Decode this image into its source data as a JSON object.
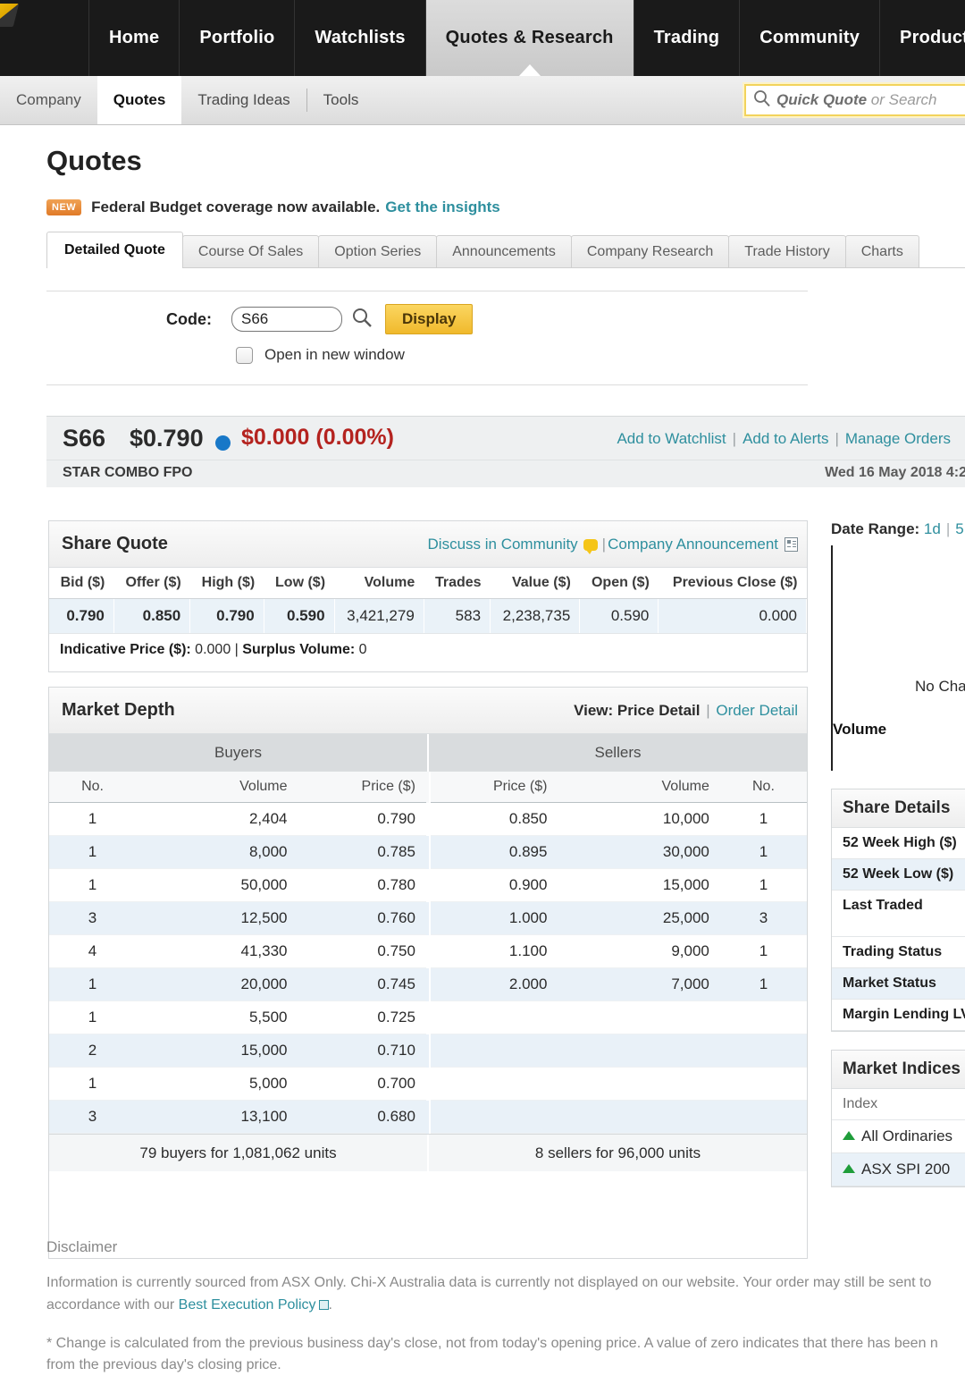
{
  "topnav": {
    "items": [
      {
        "label": "Home",
        "active": false
      },
      {
        "label": "Portfolio",
        "active": false
      },
      {
        "label": "Watchlists",
        "active": false
      },
      {
        "label": "Quotes & Research",
        "active": true
      },
      {
        "label": "Trading",
        "active": false
      },
      {
        "label": "Community",
        "active": false
      },
      {
        "label": "Products",
        "active": false
      }
    ]
  },
  "subnav": {
    "items": [
      "Company",
      "Quotes",
      "Trading Ideas",
      "Tools"
    ],
    "active": "Quotes",
    "search_placeholder_bold": "Quick Quote",
    "search_placeholder_rest": " or Search"
  },
  "page": {
    "title": "Quotes",
    "promo": {
      "badge": "NEW",
      "text": "Federal Budget coverage now available.",
      "link": "Get the insights"
    },
    "tabs": [
      {
        "label": "Detailed Quote",
        "active": true
      },
      {
        "label": "Course Of Sales",
        "active": false
      },
      {
        "label": "Option Series",
        "active": false
      },
      {
        "label": "Announcements",
        "active": false
      },
      {
        "label": "Company Research",
        "active": false
      },
      {
        "label": "Trade History",
        "active": false
      },
      {
        "label": "Charts",
        "active": false
      }
    ],
    "form": {
      "code_label": "Code:",
      "code_value": "S66",
      "display_button": "Display",
      "open_new_window": "Open in new window"
    }
  },
  "quote": {
    "code": "S66",
    "price": "$0.790",
    "change": "$0.000 (0.00%)",
    "company_name": "STAR COMBO FPO",
    "timestamp": "Wed 16 May 2018 4:2",
    "links": [
      "Add to Watchlist",
      "Add to Alerts",
      "Manage Orders"
    ],
    "dot_color": "#1878c8",
    "change_color": "#b4231f"
  },
  "share_quote": {
    "title": "Share Quote",
    "link_discuss": "Discuss in Community",
    "link_announcement": "Company Announcement",
    "headers": [
      "Bid ($)",
      "Offer ($)",
      "High ($)",
      "Low ($)",
      "Volume",
      "Trades",
      "Value ($)",
      "Open ($)",
      "Previous Close ($)"
    ],
    "values": [
      "0.790",
      "0.850",
      "0.790",
      "0.590",
      "3,421,279",
      "583",
      "2,238,735",
      "0.590",
      "0.000"
    ],
    "indicative_label": "Indicative Price ($):",
    "indicative_value": "0.000",
    "surplus_label": "Surplus Volume:",
    "surplus_value": "0"
  },
  "market_depth": {
    "title": "Market Depth",
    "view_label": "View: Price Detail",
    "view_link": "Order Detail",
    "buyers_label": "Buyers",
    "sellers_label": "Sellers",
    "headers": [
      "No.",
      "Volume",
      "Price ($)",
      "Price ($)",
      "Volume",
      "No."
    ],
    "rows": [
      {
        "bno": "1",
        "bvol": "2,404",
        "bpr": "0.790",
        "spr": "0.850",
        "svol": "10,000",
        "sno": "1"
      },
      {
        "bno": "1",
        "bvol": "8,000",
        "bpr": "0.785",
        "spr": "0.895",
        "svol": "30,000",
        "sno": "1"
      },
      {
        "bno": "1",
        "bvol": "50,000",
        "bpr": "0.780",
        "spr": "0.900",
        "svol": "15,000",
        "sno": "1"
      },
      {
        "bno": "3",
        "bvol": "12,500",
        "bpr": "0.760",
        "spr": "1.000",
        "svol": "25,000",
        "sno": "3"
      },
      {
        "bno": "4",
        "bvol": "41,330",
        "bpr": "0.750",
        "spr": "1.100",
        "svol": "9,000",
        "sno": "1"
      },
      {
        "bno": "1",
        "bvol": "20,000",
        "bpr": "0.745",
        "spr": "2.000",
        "svol": "7,000",
        "sno": "1"
      },
      {
        "bno": "1",
        "bvol": "5,500",
        "bpr": "0.725",
        "spr": "",
        "svol": "",
        "sno": ""
      },
      {
        "bno": "2",
        "bvol": "15,000",
        "bpr": "0.710",
        "spr": "",
        "svol": "",
        "sno": ""
      },
      {
        "bno": "1",
        "bvol": "5,000",
        "bpr": "0.700",
        "spr": "",
        "svol": "",
        "sno": ""
      },
      {
        "bno": "3",
        "bvol": "13,100",
        "bpr": "0.680",
        "spr": "",
        "svol": "",
        "sno": ""
      }
    ],
    "buyers_total": "79 buyers for 1,081,062 units",
    "sellers_total": "8 sellers for 96,000 units"
  },
  "right": {
    "date_range_label": "Date Range:",
    "date_range_options": [
      "1d",
      "5"
    ],
    "no_chart": "No Chart",
    "volume_label": "Volume",
    "share_details": {
      "title": "Share Details",
      "rows": [
        "52 Week High ($)",
        "52 Week Low ($)",
        "Last Traded",
        "Trading Status",
        "Market Status",
        "Margin Lending LV"
      ]
    },
    "market_indices": {
      "title": "Market Indices",
      "column": "Index",
      "rows": [
        "All Ordinaries",
        "ASX SPI 200"
      ]
    }
  },
  "disclaimer": {
    "title": "Disclaimer",
    "p1_a": "Information is currently sourced from ASX Only. Chi-X Australia data is currently not displayed on our website. Your order may still be sent to ",
    "p1_b": "accordance with our ",
    "p1_link": "Best Execution Policy",
    "p1_tail": ".",
    "p2": "* Change is calculated from the previous business day's close, not from today's opening price. A value of zero indicates that there has been n",
    "p2_b": "from the previous day's closing price."
  }
}
